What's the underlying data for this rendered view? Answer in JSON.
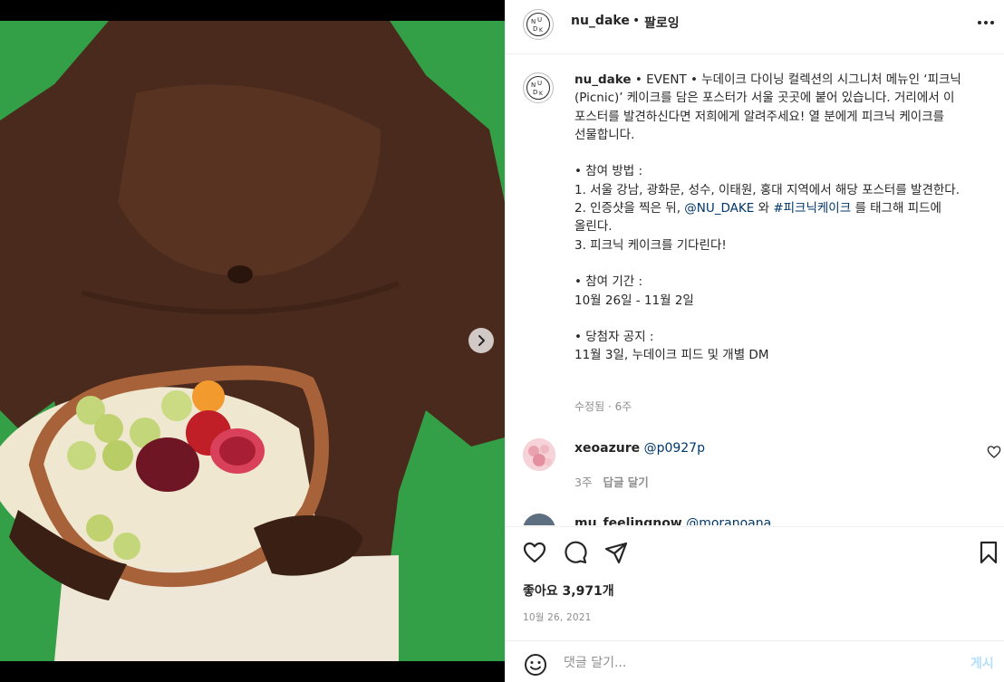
{
  "colors": {
    "background_green": "#33a048",
    "link": "#00376b",
    "muted": "#8e8e8e",
    "post_disabled": "#b2dffc"
  },
  "media": {
    "next_icon": "chevron-right-icon"
  },
  "header": {
    "username": "nu_dake",
    "separator": "•",
    "follow_label": "팔로잉",
    "more_icon": "more-horizontal-icon"
  },
  "caption": {
    "username": "nu_dake",
    "text_1": " • EVENT • 누데이크 다이닝 컬렉션의 시그니처 메뉴인 ‘피크닉(Picnic)’ 케이크를 담은 포스터가 서울 곳곳에 붙어 있습니다. 거리에서 이 포스터를 발견하신다면 저희에게 알려주세요! 열 분에게 피크닉 케이크를 선물합니다.\n\n• 참여 방법 :\n1. 서울 강남, 광화문, 성수, 이태원, 홍대 지역에서 해당 포스터를 발견한다.\n2. 인증샷을 찍은 뒤, ",
    "mention": "@NU_DAKE",
    "text_2": " 와 ",
    "hashtag": "#피크닉케이크",
    "text_3": " 를 태그해 피드에 올린다.\n3. 피크닉 케이크를 기다린다!\n\n• 참여 기간 :\n10월 26일 - 11월 2일\n\n• 당첨자 공지 :\n11월 3일, 누데이크 피드 및 개별 DM",
    "meta": "수정됨 · 6주"
  },
  "comments": [
    {
      "username": "xeoazure",
      "mention": "@p0927p",
      "time": "3주",
      "reply_label": "답글 달기"
    },
    {
      "username": "mu_feelingnow",
      "mention": "@moranoana"
    }
  ],
  "actions": {
    "like_icon": "heart-icon",
    "comment_icon": "comment-icon",
    "share_icon": "paper-plane-icon",
    "save_icon": "bookmark-icon",
    "likes_label": "좋아요 3,971개",
    "date": "10월 26, 2021"
  },
  "add_comment": {
    "placeholder": "댓글 달기...",
    "post_label": "게시",
    "emoji_icon": "smile-icon"
  }
}
